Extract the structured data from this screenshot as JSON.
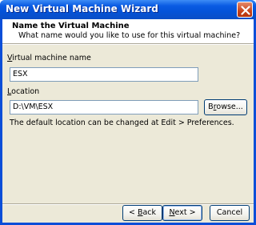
{
  "window": {
    "title": "New Virtual Machine Wizard",
    "close_icon": "close-icon"
  },
  "header": {
    "title": "Name the Virtual Machine",
    "subtitle": "What name would you like to use for this virtual machine?"
  },
  "form": {
    "name_label_access_key": "V",
    "name_label_rest": "irtual machine name",
    "name_value": "ESX",
    "location_label_access_key": "L",
    "location_label_rest": "ocation",
    "location_value": "D:\\VM\\ESX",
    "browse_label_before": "B",
    "browse_label_access_key": "r",
    "browse_label_after": "owse...",
    "info_text": "The default location can be changed at Edit > Preferences."
  },
  "buttons": {
    "back_prefix": "< ",
    "back_access_key": "B",
    "back_rest": "ack",
    "next_access_key": "N",
    "next_rest": "ext >",
    "cancel": "Cancel"
  }
}
